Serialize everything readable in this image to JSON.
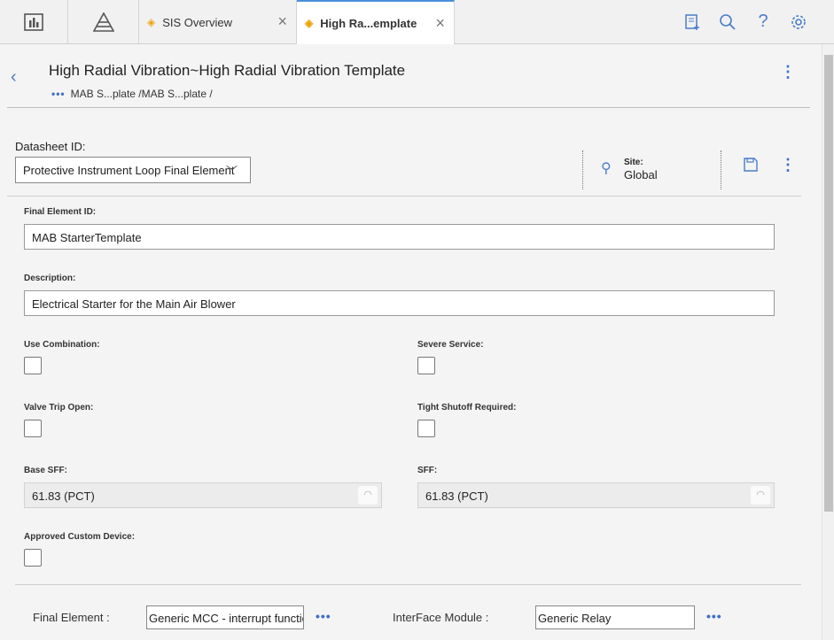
{
  "topbar": {
    "icons": [
      "dashboard-icon",
      "pyramid-icon"
    ],
    "tabs": [
      {
        "label": "SIS Overview",
        "active": false
      },
      {
        "label": "High Ra...emplate",
        "active": true
      }
    ],
    "right_icons": [
      "new-record-icon",
      "search-icon",
      "help-icon",
      "settings-icon"
    ]
  },
  "header": {
    "title": "High Radial Vibration~High Radial Vibration Template",
    "breadcrumb": "MAB S...plate /MAB S...plate /"
  },
  "datasheet": {
    "label": "Datasheet ID:",
    "value": "Protective Instrument Loop Final Element"
  },
  "site": {
    "label": "Site:",
    "value": "Global"
  },
  "form": {
    "final_element_id": {
      "label": "Final Element ID:",
      "value": "MAB StarterTemplate"
    },
    "description": {
      "label": "Description:",
      "value": "Electrical Starter for the Main Air Blower"
    },
    "use_combination": {
      "label": "Use Combination:",
      "checked": false
    },
    "severe_service": {
      "label": "Severe Service:",
      "checked": false
    },
    "valve_trip_open": {
      "label": "Valve Trip Open:",
      "checked": false
    },
    "tight_shutoff": {
      "label": "Tight Shutoff Required:",
      "checked": false
    },
    "base_sff": {
      "label": "Base SFF:",
      "value": "61.83 (PCT)"
    },
    "sff": {
      "label": "SFF:",
      "value": "61.83 (PCT)"
    },
    "approved_custom": {
      "label": "Approved Custom Device:",
      "checked": false
    }
  },
  "bottom": {
    "final_element": {
      "label": "Final Element :",
      "value": "Generic MCC - interrupt function"
    },
    "interface_module": {
      "label": "InterFace Module :",
      "value": "Generic Relay"
    }
  },
  "colors": {
    "accent": "#4a7cc9",
    "tab_icon": "#f0a30a"
  }
}
